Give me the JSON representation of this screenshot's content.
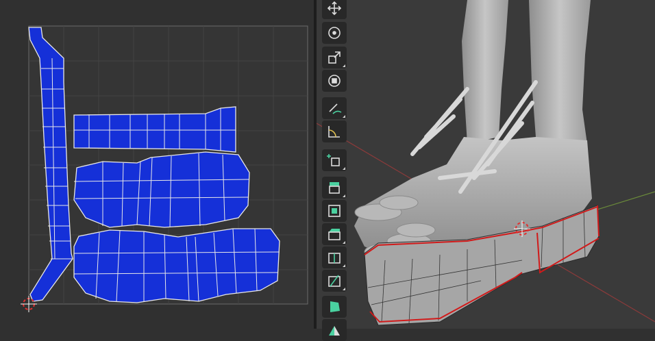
{
  "uv_editor": {
    "title": "",
    "grid_color": "#3f3f3f",
    "island_color": "#1a2fd6",
    "edge_color": "#e6e6e6",
    "cursor_icon": "2d-cursor-icon"
  },
  "viewport": {
    "toolbar": [
      {
        "name": "move-tool",
        "icon": "move-icon"
      },
      {
        "name": "rotate-tool",
        "icon": "rotate-icon"
      },
      {
        "name": "scale-tool",
        "icon": "scale-icon"
      },
      {
        "name": "transform-tool",
        "icon": "transform-icon"
      },
      {
        "name": "annotate-tool",
        "icon": "annotate-icon"
      },
      {
        "name": "measure-tool",
        "icon": "measure-icon"
      },
      {
        "name": "add-cube-tool",
        "icon": "add-cube-icon"
      },
      {
        "name": "extrude-tool",
        "icon": "extrude-icon"
      },
      {
        "name": "inset-tool",
        "icon": "inset-icon"
      },
      {
        "name": "bevel-tool",
        "icon": "bevel-icon"
      },
      {
        "name": "loop-cut-tool",
        "icon": "loop-cut-icon"
      },
      {
        "name": "knife-tool",
        "icon": "knife-icon"
      },
      {
        "name": "poly-build-tool",
        "icon": "poly-build-icon"
      },
      {
        "name": "spin-tool",
        "icon": "spin-icon"
      }
    ],
    "seam_color": "#d11a1a",
    "x_axis_color": "#8a3a3a",
    "y_axis_color": "#6a8a3a"
  }
}
